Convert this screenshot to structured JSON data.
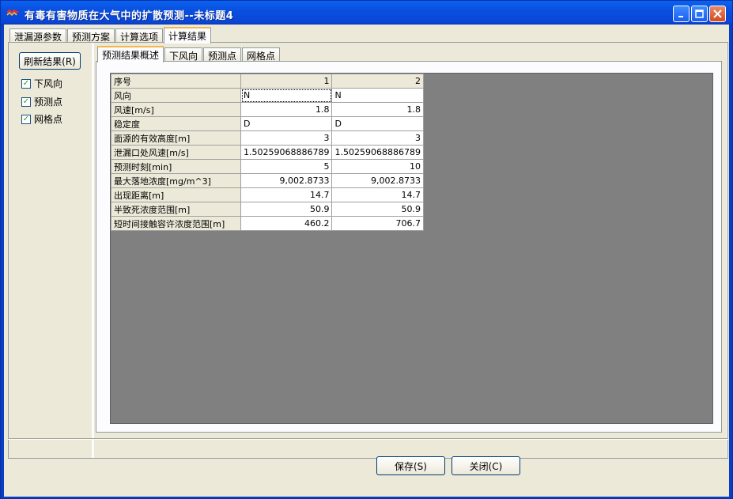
{
  "window": {
    "title": "有毒有害物质在大气中的扩散预测--未标题4"
  },
  "main_tabs": [
    {
      "label": "泄漏源参数"
    },
    {
      "label": "预测方案"
    },
    {
      "label": "计算选项"
    },
    {
      "label": "计算结果"
    }
  ],
  "left_panel": {
    "refresh_label": "刷新结果(R)",
    "checkboxes": [
      {
        "label": "下风向",
        "checked": true
      },
      {
        "label": "预测点",
        "checked": true
      },
      {
        "label": "网格点",
        "checked": true
      }
    ]
  },
  "inner_tabs": [
    {
      "label": "预测结果概述"
    },
    {
      "label": "下风向"
    },
    {
      "label": "预测点"
    },
    {
      "label": "网格点"
    }
  ],
  "results_table": {
    "header": {
      "label": "序号",
      "col1": "1",
      "col2": "2"
    },
    "rows": [
      {
        "label": "风向",
        "v1": "N",
        "v2": "N"
      },
      {
        "label": "风速[m/s]",
        "v1": "1.8",
        "v2": "1.8"
      },
      {
        "label": "稳定度",
        "v1": "D",
        "v2": "D"
      },
      {
        "label": "面源的有效高度[m]",
        "v1": "3",
        "v2": "3"
      },
      {
        "label": "泄漏口处风速[m/s]",
        "v1": "1.50259068886789",
        "v2": "1.50259068886789"
      },
      {
        "label": "预测时刻[min]",
        "v1": "5",
        "v2": "10"
      },
      {
        "label": "最大落地浓度[mg/m^3]",
        "v1": "9,002.8733",
        "v2": "9,002.8733"
      },
      {
        "label": "出现距离[m]",
        "v1": "14.7",
        "v2": "14.7"
      },
      {
        "label": "半致死浓度范围[m]",
        "v1": "50.9",
        "v2": "50.9"
      },
      {
        "label": "短时间接触容许浓度范围[m]",
        "v1": "460.2",
        "v2": "706.7"
      }
    ]
  },
  "footer": {
    "save_label": "保存(S)",
    "close_label": "关闭(C)"
  }
}
